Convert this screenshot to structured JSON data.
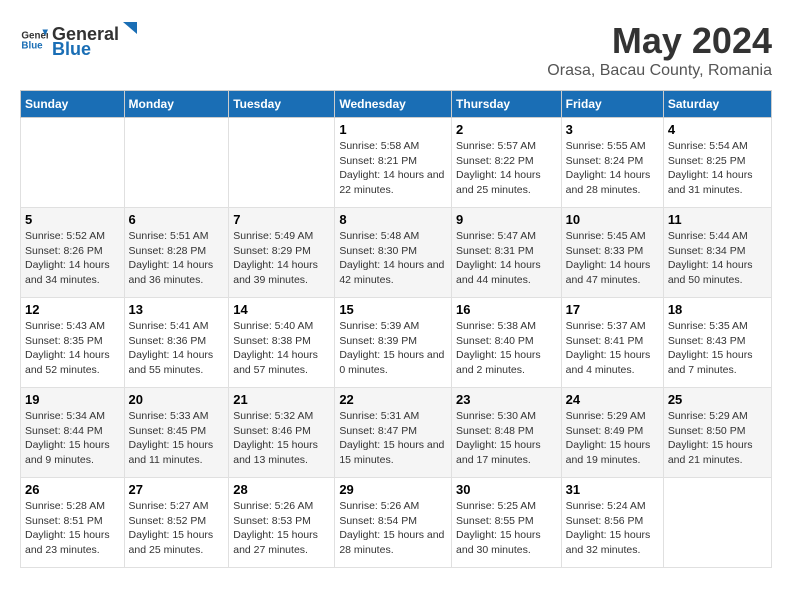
{
  "header": {
    "logo_general": "General",
    "logo_blue": "Blue",
    "title": "May 2024",
    "subtitle": "Orasa, Bacau County, Romania"
  },
  "calendar": {
    "days_of_week": [
      "Sunday",
      "Monday",
      "Tuesday",
      "Wednesday",
      "Thursday",
      "Friday",
      "Saturday"
    ],
    "weeks": [
      [
        {
          "day": "",
          "sunrise": "",
          "sunset": "",
          "daylight": "",
          "empty": true
        },
        {
          "day": "",
          "sunrise": "",
          "sunset": "",
          "daylight": "",
          "empty": true
        },
        {
          "day": "",
          "sunrise": "",
          "sunset": "",
          "daylight": "",
          "empty": true
        },
        {
          "day": "1",
          "sunrise": "5:58 AM",
          "sunset": "8:21 PM",
          "daylight": "14 hours and 22 minutes."
        },
        {
          "day": "2",
          "sunrise": "5:57 AM",
          "sunset": "8:22 PM",
          "daylight": "14 hours and 25 minutes."
        },
        {
          "day": "3",
          "sunrise": "5:55 AM",
          "sunset": "8:24 PM",
          "daylight": "14 hours and 28 minutes."
        },
        {
          "day": "4",
          "sunrise": "5:54 AM",
          "sunset": "8:25 PM",
          "daylight": "14 hours and 31 minutes."
        }
      ],
      [
        {
          "day": "5",
          "sunrise": "5:52 AM",
          "sunset": "8:26 PM",
          "daylight": "14 hours and 34 minutes."
        },
        {
          "day": "6",
          "sunrise": "5:51 AM",
          "sunset": "8:28 PM",
          "daylight": "14 hours and 36 minutes."
        },
        {
          "day": "7",
          "sunrise": "5:49 AM",
          "sunset": "8:29 PM",
          "daylight": "14 hours and 39 minutes."
        },
        {
          "day": "8",
          "sunrise": "5:48 AM",
          "sunset": "8:30 PM",
          "daylight": "14 hours and 42 minutes."
        },
        {
          "day": "9",
          "sunrise": "5:47 AM",
          "sunset": "8:31 PM",
          "daylight": "14 hours and 44 minutes."
        },
        {
          "day": "10",
          "sunrise": "5:45 AM",
          "sunset": "8:33 PM",
          "daylight": "14 hours and 47 minutes."
        },
        {
          "day": "11",
          "sunrise": "5:44 AM",
          "sunset": "8:34 PM",
          "daylight": "14 hours and 50 minutes."
        }
      ],
      [
        {
          "day": "12",
          "sunrise": "5:43 AM",
          "sunset": "8:35 PM",
          "daylight": "14 hours and 52 minutes."
        },
        {
          "day": "13",
          "sunrise": "5:41 AM",
          "sunset": "8:36 PM",
          "daylight": "14 hours and 55 minutes."
        },
        {
          "day": "14",
          "sunrise": "5:40 AM",
          "sunset": "8:38 PM",
          "daylight": "14 hours and 57 minutes."
        },
        {
          "day": "15",
          "sunrise": "5:39 AM",
          "sunset": "8:39 PM",
          "daylight": "15 hours and 0 minutes."
        },
        {
          "day": "16",
          "sunrise": "5:38 AM",
          "sunset": "8:40 PM",
          "daylight": "15 hours and 2 minutes."
        },
        {
          "day": "17",
          "sunrise": "5:37 AM",
          "sunset": "8:41 PM",
          "daylight": "15 hours and 4 minutes."
        },
        {
          "day": "18",
          "sunrise": "5:35 AM",
          "sunset": "8:43 PM",
          "daylight": "15 hours and 7 minutes."
        }
      ],
      [
        {
          "day": "19",
          "sunrise": "5:34 AM",
          "sunset": "8:44 PM",
          "daylight": "15 hours and 9 minutes."
        },
        {
          "day": "20",
          "sunrise": "5:33 AM",
          "sunset": "8:45 PM",
          "daylight": "15 hours and 11 minutes."
        },
        {
          "day": "21",
          "sunrise": "5:32 AM",
          "sunset": "8:46 PM",
          "daylight": "15 hours and 13 minutes."
        },
        {
          "day": "22",
          "sunrise": "5:31 AM",
          "sunset": "8:47 PM",
          "daylight": "15 hours and 15 minutes."
        },
        {
          "day": "23",
          "sunrise": "5:30 AM",
          "sunset": "8:48 PM",
          "daylight": "15 hours and 17 minutes."
        },
        {
          "day": "24",
          "sunrise": "5:29 AM",
          "sunset": "8:49 PM",
          "daylight": "15 hours and 19 minutes."
        },
        {
          "day": "25",
          "sunrise": "5:29 AM",
          "sunset": "8:50 PM",
          "daylight": "15 hours and 21 minutes."
        }
      ],
      [
        {
          "day": "26",
          "sunrise": "5:28 AM",
          "sunset": "8:51 PM",
          "daylight": "15 hours and 23 minutes."
        },
        {
          "day": "27",
          "sunrise": "5:27 AM",
          "sunset": "8:52 PM",
          "daylight": "15 hours and 25 minutes."
        },
        {
          "day": "28",
          "sunrise": "5:26 AM",
          "sunset": "8:53 PM",
          "daylight": "15 hours and 27 minutes."
        },
        {
          "day": "29",
          "sunrise": "5:26 AM",
          "sunset": "8:54 PM",
          "daylight": "15 hours and 28 minutes."
        },
        {
          "day": "30",
          "sunrise": "5:25 AM",
          "sunset": "8:55 PM",
          "daylight": "15 hours and 30 minutes."
        },
        {
          "day": "31",
          "sunrise": "5:24 AM",
          "sunset": "8:56 PM",
          "daylight": "15 hours and 32 minutes."
        },
        {
          "day": "",
          "sunrise": "",
          "sunset": "",
          "daylight": "",
          "empty": true
        }
      ]
    ]
  }
}
